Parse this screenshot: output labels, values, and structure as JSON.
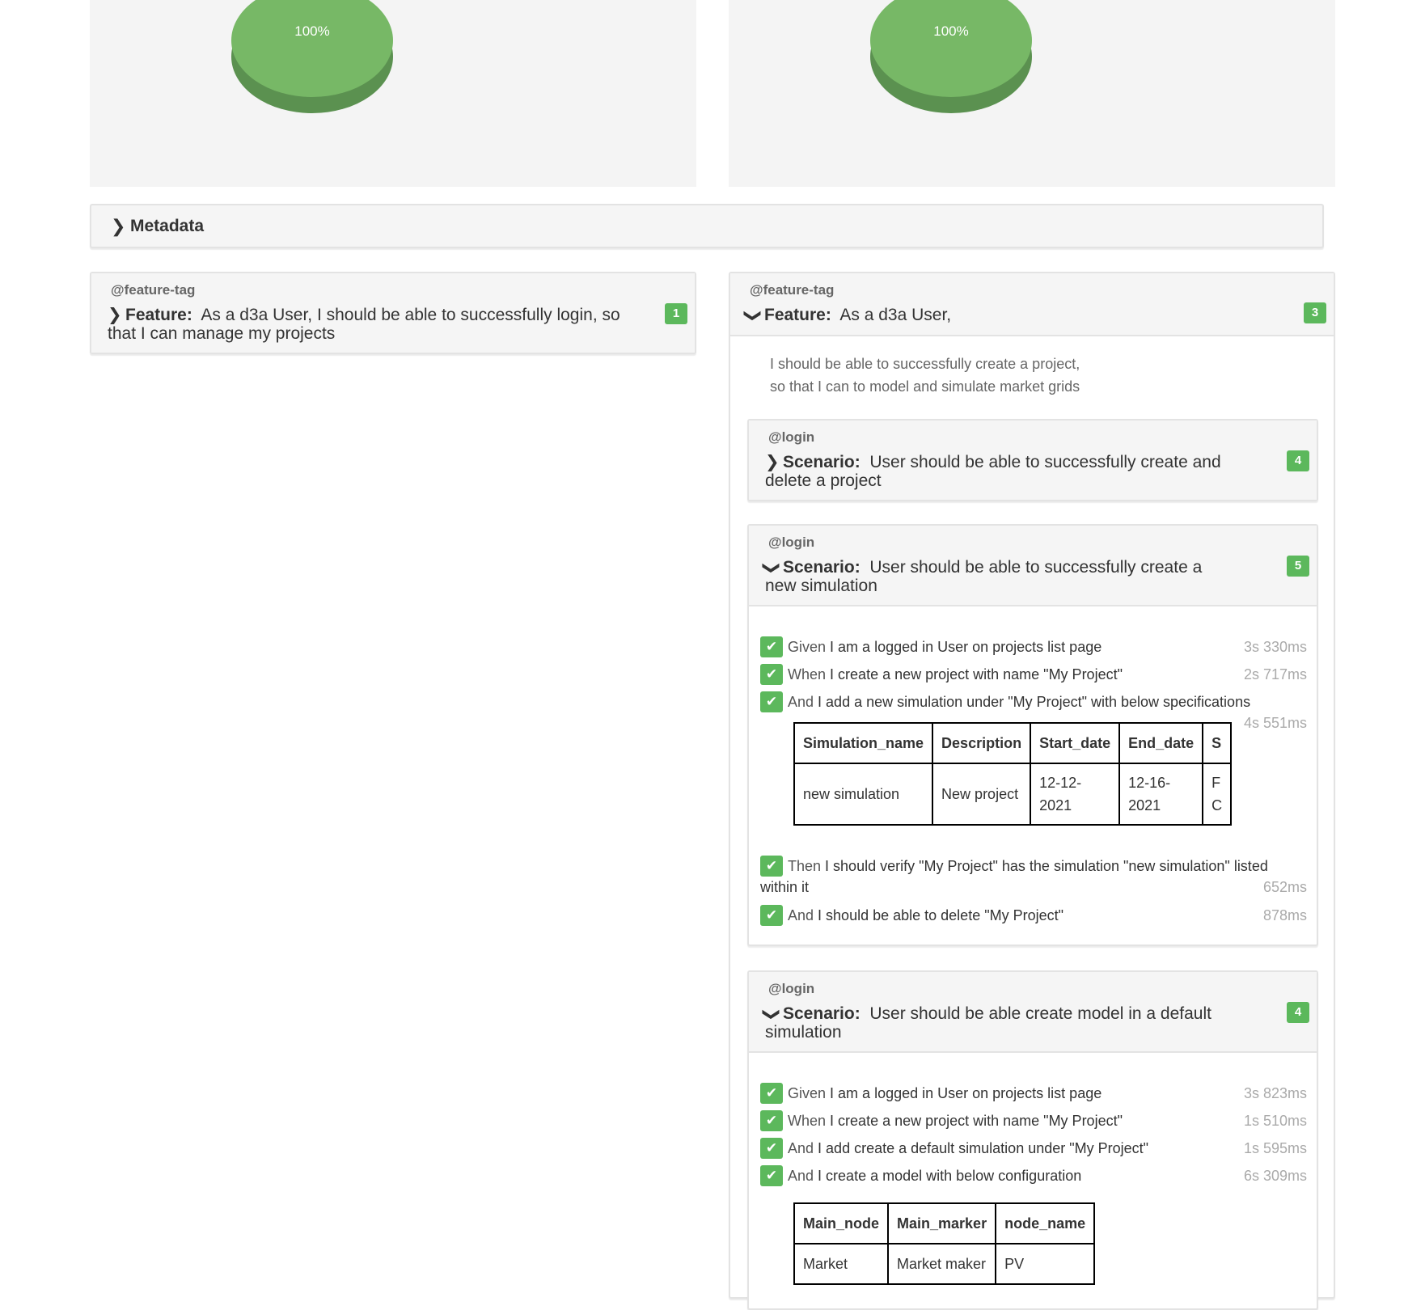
{
  "charts": [
    {
      "label": "100%",
      "color": "#77b866"
    },
    {
      "label": "100%",
      "color": "#77b866"
    }
  ],
  "metadata": {
    "label": "Metadata"
  },
  "feature1": {
    "tag": "@feature-tag",
    "keyword": "Feature:",
    "line1": "As a d3a User, I should be able to successfully login, so",
    "line2": "that I can manage my projects",
    "count": "1"
  },
  "feature2": {
    "tag": "@feature-tag",
    "keyword": "Feature:",
    "title": "As a d3a User,",
    "count": "3",
    "description": [
      "I should be able to successfully create a project,",
      "so that I can to model and simulate market grids"
    ],
    "scenarios": [
      {
        "tag": "@login",
        "keyword": "Scenario:",
        "line1": "User should be able to successfully create and",
        "line2": "delete a project",
        "count": "4"
      },
      {
        "tag": "@login",
        "keyword": "Scenario:",
        "line1": "User should be able to successfully create a",
        "line2": "new simulation",
        "count": "5",
        "steps": [
          {
            "keyword": "Given",
            "text": "I am a logged in User on projects list page",
            "duration": "3s 330ms"
          },
          {
            "keyword": "When",
            "text": "I create a new project with name \"My Project\"",
            "duration": "2s 717ms"
          },
          {
            "keyword": "And",
            "text": "I add a new simulation under \"My Project\" with below specifications",
            "duration": "4s 551ms"
          },
          {
            "keyword": "Then",
            "text": "I should verify \"My Project\" has the simulation \"new simulation\" listed",
            "text2": "within it",
            "duration": "652ms"
          },
          {
            "keyword": "And",
            "text": "I should be able to delete \"My Project\"",
            "duration": "878ms"
          }
        ],
        "table": {
          "headers": [
            "Simulation_name",
            "Description",
            "Start_date",
            "End_date",
            "S"
          ],
          "row": [
            "new simulation",
            "New project",
            "12-12-",
            "2021",
            "12-16-",
            "2021",
            "F",
            "C"
          ]
        }
      },
      {
        "tag": "@login",
        "keyword": "Scenario:",
        "line1": "User should be able create model in a default",
        "line2": "simulation",
        "count": "4",
        "steps": [
          {
            "keyword": "Given",
            "text": "I am a logged in User on projects list page",
            "duration": "3s 823ms"
          },
          {
            "keyword": "When",
            "text": "I create a new project with name \"My Project\"",
            "duration": "1s 510ms"
          },
          {
            "keyword": "And",
            "text": "I add create a default simulation under \"My Project\"",
            "duration": "1s 595ms"
          },
          {
            "keyword": "And",
            "text": "I create a model with below configuration",
            "duration": "6s 309ms"
          }
        ],
        "table": {
          "headers": [
            "Main_node",
            "Main_marker",
            "node_name"
          ],
          "row": [
            "Market",
            "Market maker",
            "PV"
          ]
        }
      }
    ]
  },
  "icons": {
    "chevron_right": "chevron-right-icon",
    "chevron_down": "chevron-down-icon",
    "check": "check-icon"
  }
}
